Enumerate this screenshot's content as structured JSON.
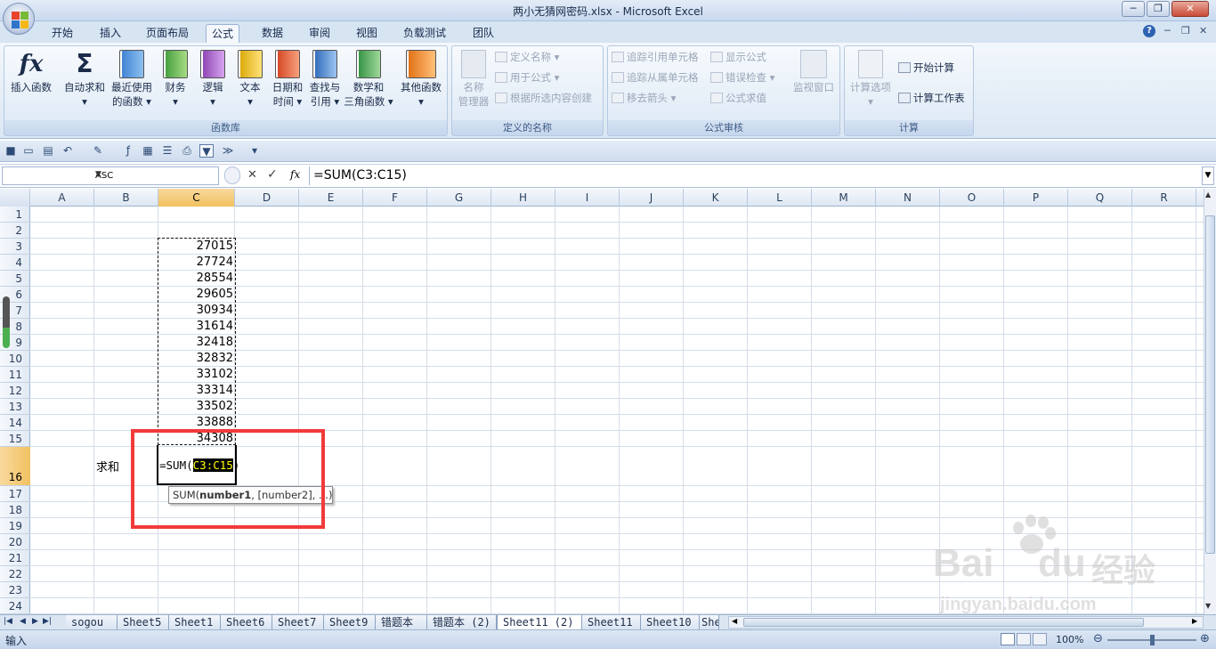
{
  "window": {
    "title": "两小无猜网密码.xlsx - Microsoft Excel",
    "btn_min": "─",
    "btn_max": "❐",
    "btn_close": "✕"
  },
  "tabs": [
    "开始",
    "插入",
    "页面布局",
    "公式",
    "数据",
    "审阅",
    "视图",
    "负载测试",
    "团队"
  ],
  "active_tab": "公式",
  "ribbon": {
    "function_library": {
      "label": "函数库",
      "buttons": [
        {
          "l1": "插入函数",
          "l2": ""
        },
        {
          "l1": "自动求和",
          "l2": "▾"
        },
        {
          "l1": "最近使用",
          "l2": "的函数 ▾"
        },
        {
          "l1": "财务",
          "l2": "▾"
        },
        {
          "l1": "逻辑",
          "l2": "▾"
        },
        {
          "l1": "文本",
          "l2": "▾"
        },
        {
          "l1": "日期和",
          "l2": "时间 ▾"
        },
        {
          "l1": "查找与",
          "l2": "引用 ▾"
        },
        {
          "l1": "数学和",
          "l2": "三角函数 ▾"
        },
        {
          "l1": "其他函数",
          "l2": "▾"
        }
      ]
    },
    "defined_names": {
      "label": "定义的名称",
      "name_manager_l1": "名称",
      "name_manager_l2": "管理器",
      "define_name": "定义名称 ▾",
      "use_in_formula": "用于公式 ▾",
      "create_from_selection": "根据所选内容创建"
    },
    "formula_auditing": {
      "label": "公式审核",
      "trace_precedents": "追踪引用单元格",
      "trace_dependents": "追踪从属单元格",
      "remove_arrows": "移去箭头 ▾",
      "show_formulas": "显示公式",
      "error_checking": "错误检查 ▾",
      "evaluate_formula": "公式求值",
      "watch_window": "监视窗口"
    },
    "calculation": {
      "label": "计算",
      "calc_options": "计算选项",
      "calc_now": "开始计算",
      "calc_sheet": "计算工作表"
    }
  },
  "qat": {
    "more": "▾"
  },
  "formula_bar": {
    "name_box": "ASC",
    "formula": "=SUM(C3:C15)",
    "fx": "fx",
    "cancel": "✕",
    "enter": "✓"
  },
  "grid": {
    "columns": [
      "A",
      "B",
      "C",
      "D",
      "E",
      "F",
      "G",
      "H",
      "I",
      "J",
      "K",
      "L",
      "M",
      "N",
      "O",
      "P",
      "Q",
      "R"
    ],
    "rows": [
      "1",
      "2",
      "3",
      "4",
      "5",
      "6",
      "7",
      "8",
      "9",
      "10",
      "11",
      "12",
      "13",
      "14",
      "15",
      "16",
      "17",
      "18",
      "19",
      "20",
      "21",
      "22",
      "23",
      "24"
    ],
    "c_values": [
      "27015",
      "27724",
      "28554",
      "29605",
      "30934",
      "31614",
      "32418",
      "32832",
      "33102",
      "33314",
      "33502",
      "33888",
      "34308"
    ],
    "b16": "求和",
    "c16_prefix": "=SUM(",
    "c16_ref": "C3:C15",
    "c16_suffix": ")",
    "tooltip_pre": "SUM(",
    "tooltip_bold": "number1",
    "tooltip_post": ", [number2], ...)"
  },
  "sheets": [
    "sogou",
    "Sheet5",
    "Sheet1",
    "Sheet6",
    "Sheet7",
    "Sheet9",
    "错题本",
    "错题本 (2)",
    "Sheet11 (2)",
    "Sheet11",
    "Sheet10",
    "She"
  ],
  "active_sheet": "Sheet11 (2)",
  "status": {
    "mode": "输入",
    "zoom": "100%"
  },
  "watermark": {
    "brand": "Bai",
    "brand2": "du",
    "brand_cn": "经验",
    "url": "jingyan.baidu.com"
  },
  "colors": {
    "accent": "#f23a3a",
    "selected_header": "#f1c15f"
  }
}
